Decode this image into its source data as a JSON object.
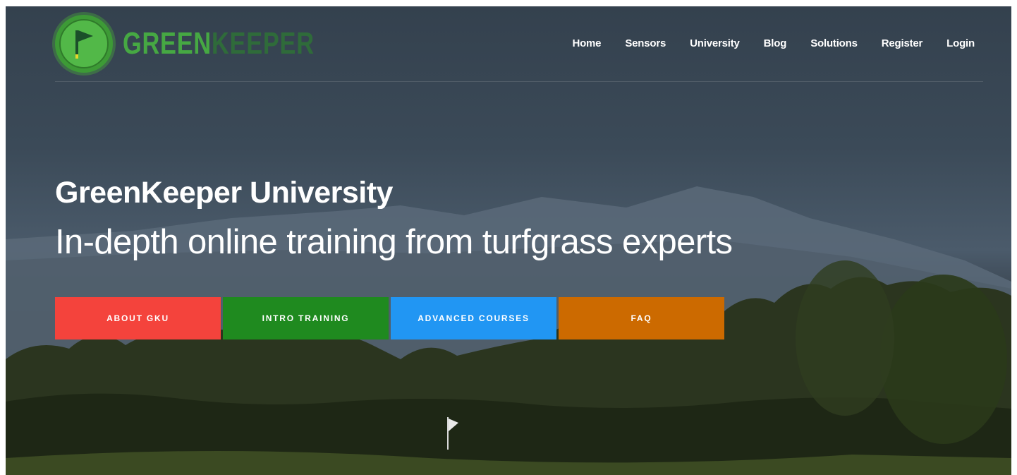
{
  "brand": {
    "name_part1": "GREEN",
    "name_part2": "KEEPER"
  },
  "nav": {
    "items": [
      {
        "label": "Home"
      },
      {
        "label": "Sensors"
      },
      {
        "label": "University"
      },
      {
        "label": "Blog"
      },
      {
        "label": "Solutions"
      },
      {
        "label": "Register"
      },
      {
        "label": "Login"
      }
    ]
  },
  "hero": {
    "title": "GreenKeeper University",
    "subtitle": "In-depth online training from turfgrass experts"
  },
  "buttons": [
    {
      "label": "ABOUT GKU",
      "color": "#f4433c"
    },
    {
      "label": "INTRO TRAINING",
      "color": "#1f8a1f"
    },
    {
      "label": "ADVANCED COURSES",
      "color": "#2196f3"
    },
    {
      "label": "FAQ",
      "color": "#cc6a00"
    }
  ],
  "colors": {
    "brand_green": "#46a843",
    "brand_dark_green": "#2f6b3a"
  },
  "icons": {
    "logo": "golf-flag-icon"
  }
}
